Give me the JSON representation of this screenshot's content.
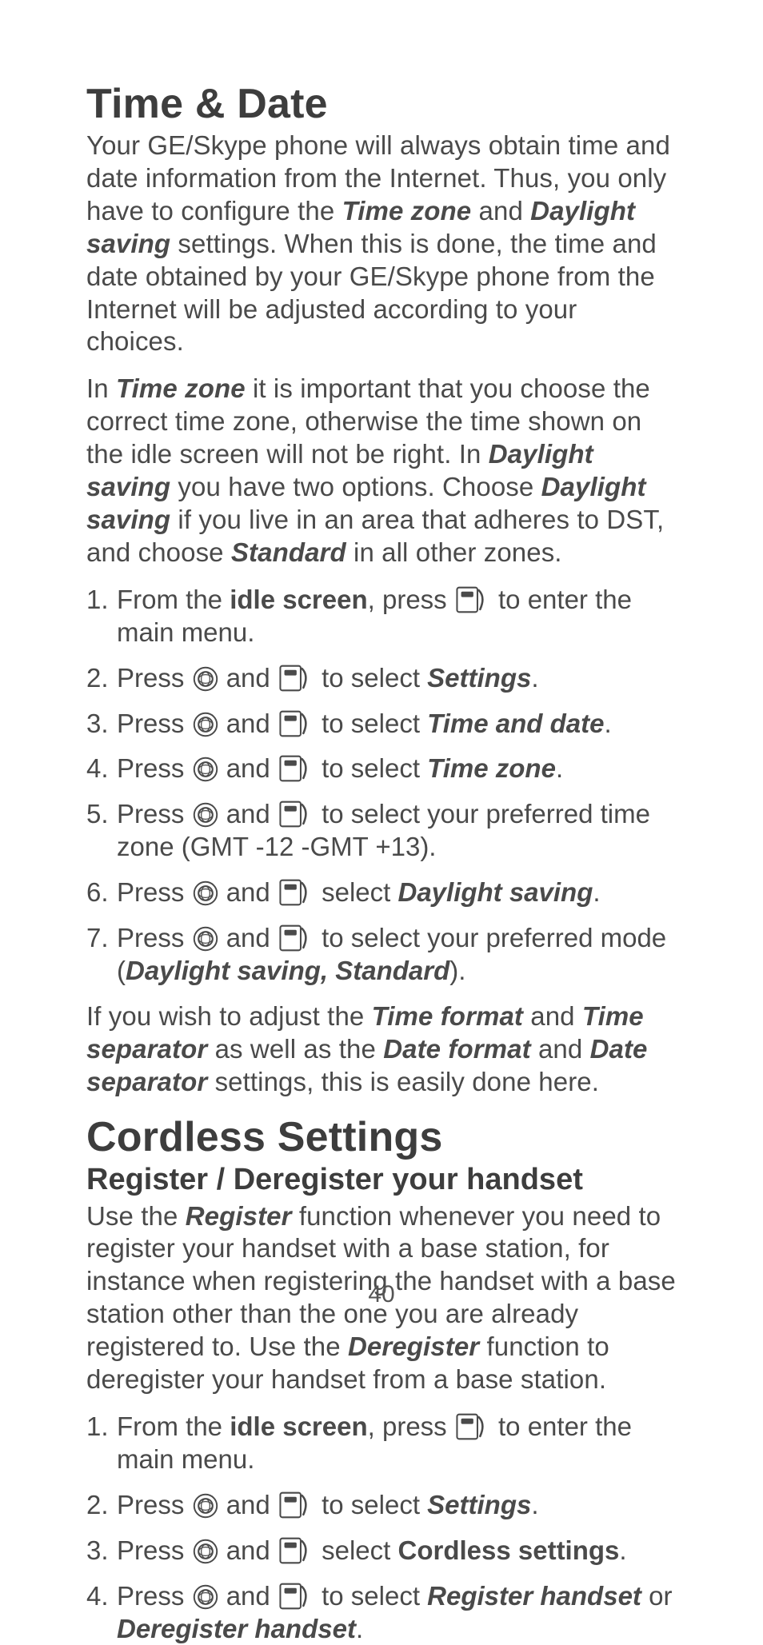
{
  "section1": {
    "heading": "Time & Date",
    "para1": {
      "t1": "Your GE/Skype phone will always obtain time and date information from the Internet. Thus, you only have to configure the ",
      "b1": "Time zone",
      "t2": " and ",
      "b2": "Daylight saving",
      "t3": " settings. When this is done, the time and date obtained by your GE/Skype phone from the Internet will be adjusted according to your choices."
    },
    "para2": {
      "t1": "In ",
      "b1": "Time zone",
      "t2": " it is important that you choose the correct time zone, otherwise the time shown on the idle screen will not be right. In ",
      "b2": "Daylight saving",
      "t3": " you have two options. Choose ",
      "b3": "Daylight saving",
      "t4": " if you live in an area that adheres to DST, and choose ",
      "b4": "Standard",
      "t5": " in all other zones."
    },
    "steps": [
      {
        "pre": "From the ",
        "b1": "idle screen",
        "mid": ", press  ",
        "post": " to enter the main menu."
      },
      {
        "pre": "Press ",
        "mid": " and  ",
        "post1": " to select ",
        "b1": "Settings",
        "post2": "."
      },
      {
        "pre": "Press ",
        "mid": " and  ",
        "post1": " to select ",
        "b1": "Time and date",
        "post2": "."
      },
      {
        "pre": "Press ",
        "mid": " and  ",
        "post1": " to select ",
        "b1": "Time zone",
        "post2": "."
      },
      {
        "pre": "Press ",
        "mid": " and  ",
        "post1": " to select your preferred time zone (GMT -12 -GMT +13)."
      },
      {
        "pre": "Press ",
        "mid": " and  ",
        "post1": " select ",
        "b1": "Daylight saving",
        "post2": "."
      },
      {
        "pre": "Press ",
        "mid": " and  ",
        "post1": " to select your preferred mode (",
        "b1": "Daylight saving, Standard",
        "post2": ")."
      }
    ],
    "para3": {
      "t1": "If you wish to adjust the ",
      "b1": "Time format",
      "t2": " and ",
      "b2": "Time separator",
      "t3": " as well as the ",
      "b3": "Date format",
      "t4": " and ",
      "b4": "Date separator",
      "t5": " settings, this is easily done here."
    }
  },
  "section2": {
    "heading": "Cordless Settings",
    "subheading": "Register / Deregister your handset",
    "para1": {
      "t1": "Use the ",
      "b1": "Register",
      "t2": " function whenever you need to register your handset with a base station, for instance when registering the handset with a base station other than the one you are already registered to. Use the ",
      "b2": "Deregister",
      "t3": " function to deregister your handset from a base station."
    },
    "steps": [
      {
        "pre": "From the ",
        "b1": "idle screen",
        "mid": ", press  ",
        "post": " to enter the main menu."
      },
      {
        "pre": "Press ",
        "mid": " and  ",
        "post1": " to select ",
        "b1": "Settings",
        "post2": "."
      },
      {
        "pre": "Press ",
        "mid": " and  ",
        "post1": " select ",
        "b1": "Cordless settings",
        "post2": "."
      },
      {
        "pre": "Press ",
        "mid": " and  ",
        "post1": " to select ",
        "b1": "Register handset",
        "t_or": " or ",
        "b2": "Deregister handset",
        "post2": "."
      }
    ]
  },
  "pageNumber": "40"
}
